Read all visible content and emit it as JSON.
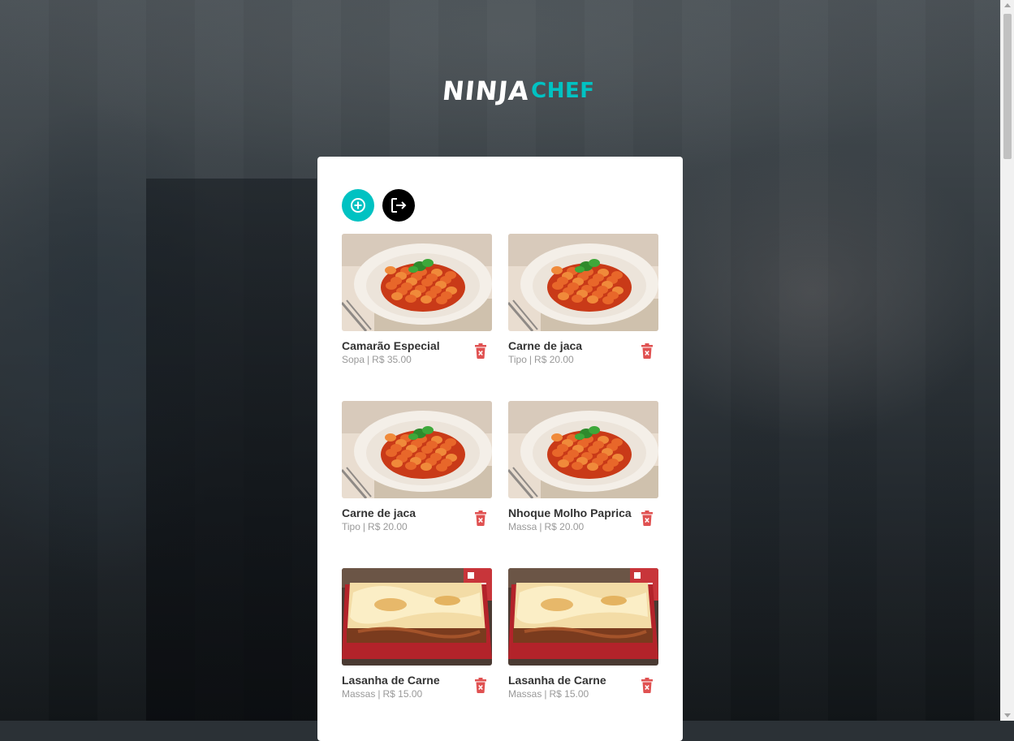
{
  "app": {
    "logo_part1": "NINJA",
    "logo_part2": "CHEF",
    "accent_color": "#00c2c2",
    "danger_color": "#e05151"
  },
  "toolbar": {
    "add_icon": "plus-circle-icon",
    "logout_icon": "logout-icon"
  },
  "dishes": [
    {
      "title": "Camarão Especial",
      "category": "Sopa",
      "price": "R$ 35.00",
      "image": "gnocchi"
    },
    {
      "title": "Carne de jaca",
      "category": "Tipo",
      "price": "R$ 20.00",
      "image": "gnocchi"
    },
    {
      "title": "Carne de jaca",
      "category": "Tipo",
      "price": "R$ 20.00",
      "image": "gnocchi"
    },
    {
      "title": "Nhoque Molho Paprica",
      "category": "Massa",
      "price": "R$ 20.00",
      "image": "gnocchi"
    },
    {
      "title": "Lasanha de Carne",
      "category": "Massas",
      "price": "R$ 15.00",
      "image": "lasagna"
    },
    {
      "title": "Lasanha de Carne",
      "category": "Massas",
      "price": "R$ 15.00",
      "image": "lasagna"
    }
  ],
  "separator": "|"
}
